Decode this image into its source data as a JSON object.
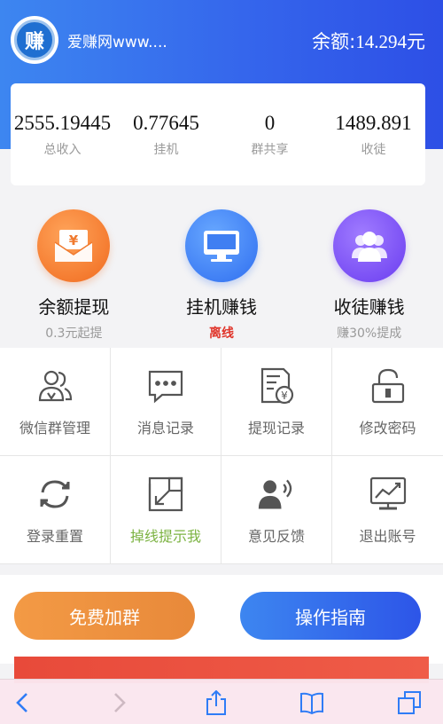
{
  "header": {
    "logo_char": "赚",
    "site_name": "爱赚网www....",
    "balance_label": "余额:",
    "balance_value": "14.294元"
  },
  "stats": [
    {
      "value": "2555.19445",
      "label": "总收入"
    },
    {
      "value": "0.77645",
      "label": "挂机"
    },
    {
      "value": "0",
      "label": "群共享"
    },
    {
      "value": "1489.891",
      "label": "收徒"
    }
  ],
  "features": [
    {
      "icon": "withdraw-icon",
      "title": "余额提现",
      "sub": "0.3元起提"
    },
    {
      "icon": "monitor-icon",
      "title": "挂机赚钱",
      "sub": "离线"
    },
    {
      "icon": "people-icon",
      "title": "收徒赚钱",
      "sub": "赚30%提成"
    }
  ],
  "grid": [
    {
      "icon": "group-manage-icon",
      "label": "微信群管理"
    },
    {
      "icon": "message-icon",
      "label": "消息记录"
    },
    {
      "icon": "withdraw-record-icon",
      "label": "提现记录"
    },
    {
      "icon": "lock-icon",
      "label": "修改密码"
    },
    {
      "icon": "refresh-icon",
      "label": "登录重置"
    },
    {
      "icon": "resize-icon",
      "label": "掉线提示我"
    },
    {
      "icon": "feedback-icon",
      "label": "意见反馈"
    },
    {
      "icon": "logout-icon",
      "label": "退出账号"
    }
  ],
  "buttons": {
    "join_group": "免费加群",
    "guide": "操作指南"
  },
  "colors": {
    "primary_blue": "#3566ec",
    "orange": "#f06a1e",
    "purple": "#6a3cf0",
    "offline_red": "#e0352b",
    "toolbar_blue": "#2f7cf6"
  },
  "toolbar": [
    "back-icon",
    "forward-icon",
    "share-icon",
    "bookmarks-icon",
    "tabs-icon"
  ]
}
